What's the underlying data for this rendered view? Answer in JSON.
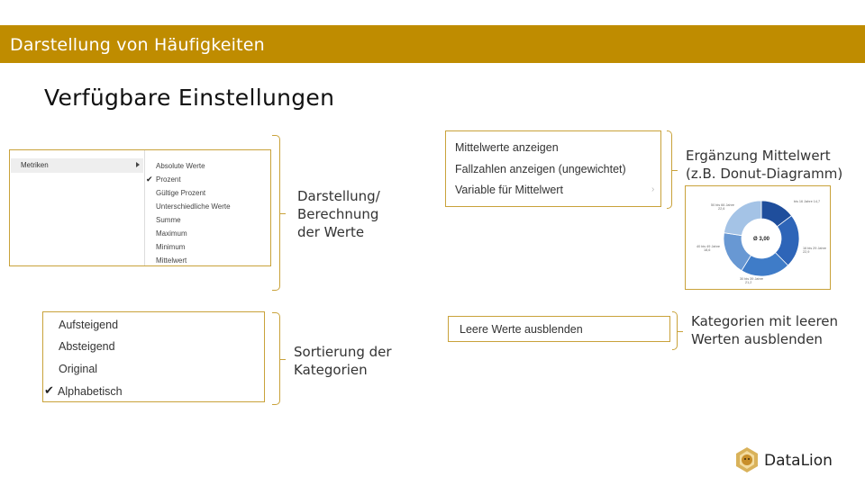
{
  "header": {
    "title": "Darstellung von Häufigkeiten"
  },
  "page_title": "Verfügbare Einstellungen",
  "metrics_menu": {
    "parent_label": "Metriken",
    "items": [
      "Absolute Werte",
      "Prozent",
      "Gültige Prozent",
      "Unterschiedliche Werte",
      "Summe",
      "Maximum",
      "Minimum",
      "Mittelwert"
    ],
    "checked": "Prozent"
  },
  "metrics_caption": [
    "Darstellung/",
    "Berechnung",
    "der Werte"
  ],
  "sort_menu": {
    "items": [
      "Aufsteigend",
      "Absteigend",
      "Original",
      "Alphabetisch"
    ],
    "checked": "Alphabetisch"
  },
  "sort_caption": [
    "Sortierung der",
    "Kategorien"
  ],
  "mean_menu": {
    "items": [
      "Mittelwerte anzeigen",
      "Fallzahlen anzeigen (ungewichtet)",
      "Variable für Mittelwert"
    ]
  },
  "mean_caption": [
    "Ergänzung Mittelwert",
    "(z.B. Donut-Diagramm)"
  ],
  "donut": {
    "center_label": "Ø 3,00",
    "segments": [
      {
        "label": "bis 16 Jahre",
        "value": 14.7,
        "color": "#1f4e9c"
      },
      {
        "label": "16 bis 29 Jahre",
        "value": 22.9,
        "color": "#2e65b8"
      },
      {
        "label": "30 bis 39 Jahre",
        "value": 21.2,
        "color": "#3f7cc8"
      },
      {
        "label": "40 bis 49 Jahre",
        "value": 18.6,
        "color": "#6898d3"
      },
      {
        "label": "50 bis 66 Jahre",
        "value": 22.6,
        "color": "#a4c3e6"
      }
    ]
  },
  "empty_menu": {
    "item": "Leere Werte ausblenden"
  },
  "empty_caption": [
    "Kategorien mit leeren",
    "Werten ausblenden"
  ],
  "brand": {
    "name": "DataLion",
    "accent": "#bf8c00"
  }
}
